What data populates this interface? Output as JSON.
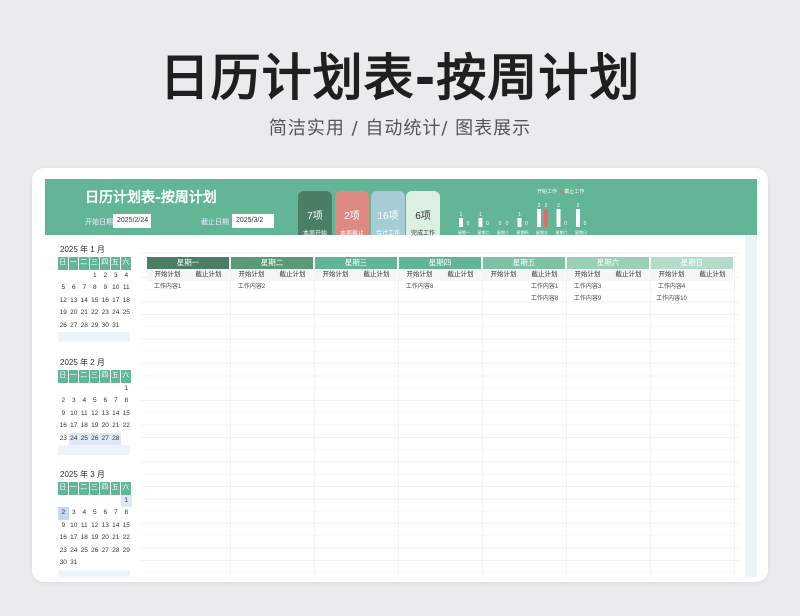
{
  "page": {
    "title": "日历计划表-按周计划",
    "subtitle": "简洁实用 / 自动统计/ 图表展示"
  },
  "sheet": {
    "title": "日历计划表-按周计划",
    "start_label": "开始日期",
    "start_value": "2025/2/24",
    "end_label": "截止日期",
    "end_value": "2025/3/2"
  },
  "stats": [
    {
      "num": "7项",
      "label": "本周开始",
      "color": "#4a7e65"
    },
    {
      "num": "2项",
      "label": "本周截止",
      "color": "#de8a82"
    },
    {
      "num": "16项",
      "label": "合计工作",
      "color": "#a6cdd6"
    },
    {
      "num": "6项",
      "label": "完成工作",
      "color": "#dcefe3"
    }
  ],
  "chart_data": {
    "type": "bar",
    "categories": [
      "星期一",
      "星期二",
      "星期三",
      "星期四",
      "星期五",
      "星期六",
      "星期日"
    ],
    "series": [
      {
        "name": "开始工作",
        "values": [
          1,
          1,
          0,
          1,
          2,
          2,
          2
        ],
        "color": "#ffffff"
      },
      {
        "name": "截止工作",
        "values": [
          0,
          0,
          0,
          0,
          2,
          0,
          0
        ],
        "color": "#e66a63"
      }
    ],
    "ylim": [
      0,
      2
    ],
    "legend": "top"
  },
  "calendars": [
    {
      "title": "2025  年   1   月",
      "head": [
        "日",
        "一",
        "二",
        "三",
        "四",
        "五",
        "六"
      ],
      "rows": [
        [
          "",
          "",
          "",
          "1",
          "2",
          "3",
          "4"
        ],
        [
          "5",
          "6",
          "7",
          "8",
          "9",
          "10",
          "11"
        ],
        [
          "12",
          "13",
          "14",
          "15",
          "16",
          "17",
          "18"
        ],
        [
          "19",
          "20",
          "21",
          "22",
          "23",
          "24",
          "25"
        ],
        [
          "26",
          "27",
          "28",
          "29",
          "30",
          "31",
          ""
        ]
      ]
    },
    {
      "title": "2025  年   2   月",
      "head": [
        "日",
        "一",
        "二",
        "三",
        "四",
        "五",
        "六"
      ],
      "rows": [
        [
          "",
          "",
          "",
          "",
          "",
          "",
          "1"
        ],
        [
          "2",
          "3",
          "4",
          "5",
          "6",
          "7",
          "8"
        ],
        [
          "9",
          "10",
          "11",
          "12",
          "13",
          "14",
          "15"
        ],
        [
          "16",
          "17",
          "18",
          "19",
          "20",
          "21",
          "22"
        ],
        [
          "23",
          "24",
          "25",
          "26",
          "27",
          "28",
          ""
        ]
      ]
    },
    {
      "title": "2025  年   3   月",
      "head": [
        "日",
        "一",
        "二",
        "三",
        "四",
        "五",
        "六"
      ],
      "rows": [
        [
          "",
          "",
          "",
          "",
          "",
          "",
          "1"
        ],
        [
          "2",
          "3",
          "4",
          "5",
          "6",
          "7",
          "8"
        ],
        [
          "9",
          "10",
          "11",
          "12",
          "13",
          "14",
          "15"
        ],
        [
          "16",
          "17",
          "18",
          "19",
          "20",
          "21",
          "22"
        ],
        [
          "23",
          "24",
          "25",
          "26",
          "27",
          "28",
          "29"
        ],
        [
          "30",
          "31",
          "",
          "",
          "",
          "",
          ""
        ]
      ]
    }
  ],
  "week": {
    "sub_start": "开始计划",
    "sub_end": "截止计划",
    "days": [
      {
        "name": "星期一",
        "color": "#4a7e65",
        "start": [
          "工作内容1"
        ],
        "end": []
      },
      {
        "name": "星期二",
        "color": "#5a9a77",
        "start": [
          "工作内容2"
        ],
        "end": []
      },
      {
        "name": "星期三",
        "color": "#62b595",
        "start": [],
        "end": []
      },
      {
        "name": "星期四",
        "color": "#62b595",
        "start": [
          "工作内容8"
        ],
        "end": []
      },
      {
        "name": "星期五",
        "color": "#7dc2a4",
        "start": [],
        "end": [
          "工作内容1",
          "工作内容8"
        ]
      },
      {
        "name": "星期六",
        "color": "#9bd0b6",
        "start": [
          "工作内容3",
          "工作内容9"
        ],
        "end": []
      },
      {
        "name": "星期日",
        "color": "#b4dcc8",
        "start": [
          "工作内容4",
          "工作内容10"
        ],
        "end": []
      }
    ]
  }
}
